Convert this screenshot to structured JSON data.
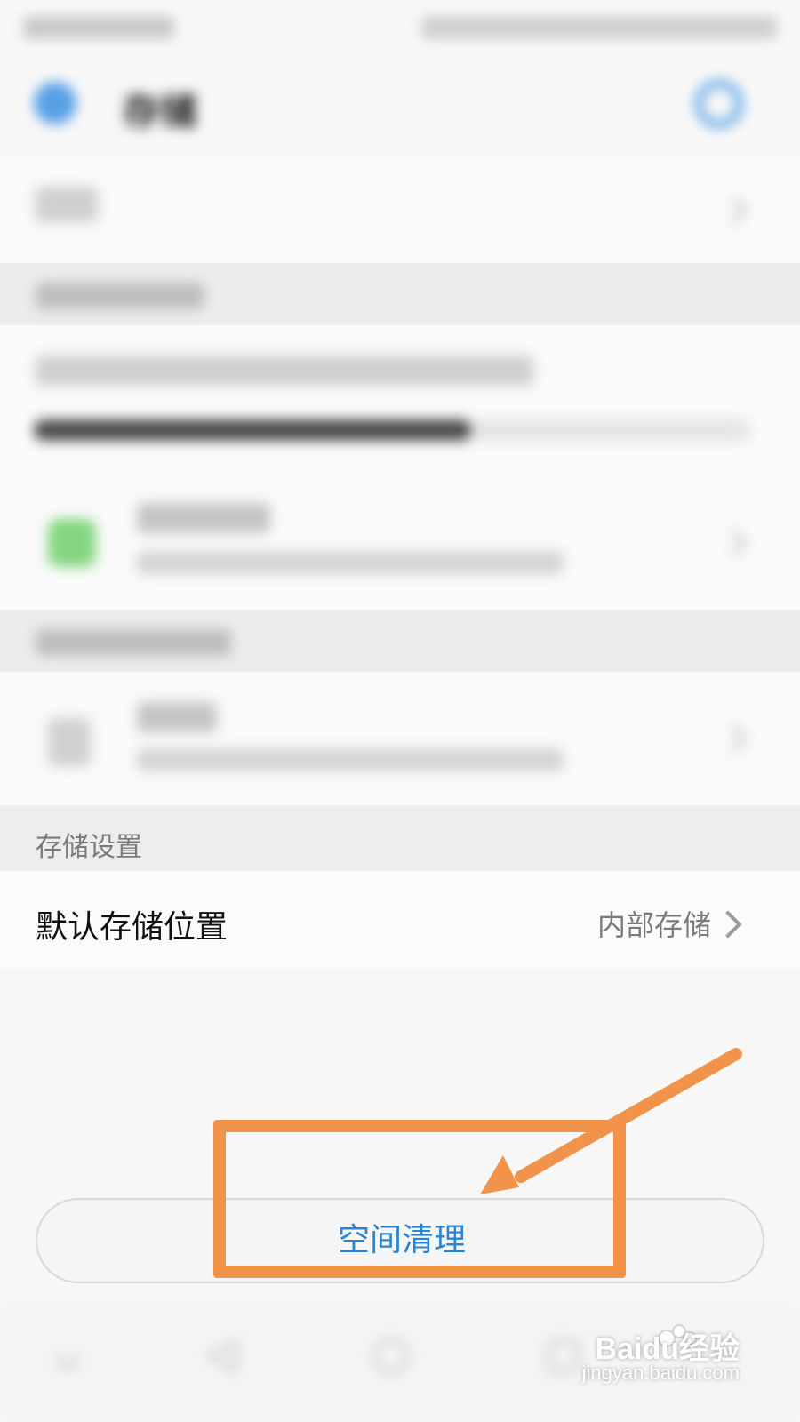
{
  "app": {
    "header_title": "存储"
  },
  "sections": {
    "storage_settings_title": "存储设置"
  },
  "default_location": {
    "label": "默认存储位置",
    "value": "内部存储"
  },
  "cleanup_button": {
    "label": "空间清理"
  },
  "watermark": {
    "main_text": "Baidu经验",
    "sub_text": "jingyan.baidu.com"
  },
  "usage": {
    "fraction_used": 0.61
  },
  "colors": {
    "accent_blue": "#2a84d5",
    "highlight_orange": "#f1934a"
  },
  "icons": {
    "back": "back-arrow-icon",
    "search": "search-icon",
    "chevron": "chevron-right-icon",
    "internal_storage": "internal-storage-icon",
    "sd_card": "sd-card-icon",
    "nav_back": "nav-back-icon",
    "nav_home": "nav-home-icon",
    "nav_recent": "nav-recent-icon",
    "nav_hide": "nav-hide-icon"
  }
}
